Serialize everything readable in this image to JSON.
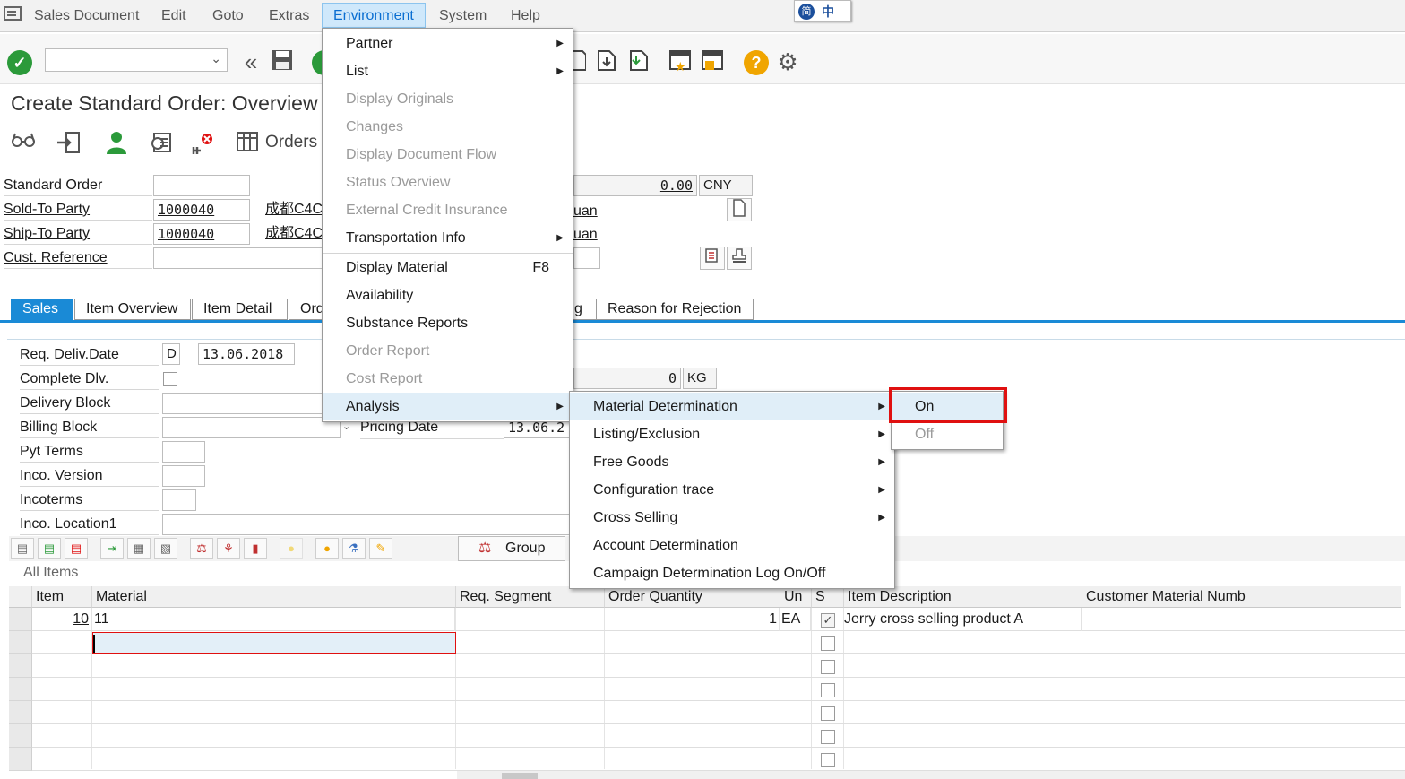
{
  "menubar": {
    "items": [
      "Sales Document",
      "Edit",
      "Goto",
      "Extras",
      "Environment",
      "System",
      "Help"
    ],
    "active": "Environment",
    "ime": {
      "a": "简",
      "b": "中"
    }
  },
  "title": "Create Standard Order: Overview",
  "app_toolbar": {
    "orders_label": "Orders"
  },
  "header": {
    "standard_order_label": "Standard Order",
    "sold_to_label": "Sold-To Party",
    "sold_to_value": "1000040",
    "sold_to_name": "成都C4C",
    "ship_to_label": "Ship-To Party",
    "ship_to_value": "1000040",
    "ship_to_name": "成都C4C",
    "cust_ref_label": "Cust. Reference",
    "net_value": "0.00",
    "currency": "CNY",
    "partial_uan_1": "uan",
    "partial_uan_2": "uan"
  },
  "tabs": [
    "Sales",
    "Item Overview",
    "Item Detail",
    "Ord",
    "g",
    "Reason for Rejection"
  ],
  "sales_tab": {
    "req_deliv_label": "Req. Deliv.Date",
    "req_deliv_type": "D",
    "req_deliv_value": "13.06.2018",
    "complete_dlv_label": "Complete Dlv.",
    "delivery_block_label": "Delivery Block",
    "billing_block_label": "Billing Block",
    "pyt_terms_label": "Pyt Terms",
    "inco_version_label": "Inco. Version",
    "incoterms_label": "Incoterms",
    "inco_location_label": "Inco. Location1",
    "weight_value": "0",
    "weight_unit": "KG",
    "pricing_date_label": "Pricing Date",
    "pricing_date_value": "13.06.2"
  },
  "items": {
    "group_label": "Group",
    "all_items_label": "All Items",
    "columns": [
      "Item",
      "Material",
      "Req. Segment",
      "Order Quantity",
      "Un",
      "S",
      "Item Description",
      "Customer Material Numb"
    ],
    "rows": [
      {
        "item": "10",
        "material": "11",
        "req_segment": "",
        "quantity": "1",
        "unit": "EA",
        "checked": true,
        "description": "Jerry cross selling product A",
        "cust_mat": ""
      }
    ]
  },
  "environment_menu": [
    {
      "label": "Partner",
      "disabled": false,
      "submenu": true
    },
    {
      "label": "List",
      "disabled": false,
      "submenu": true
    },
    {
      "label": "Display Originals",
      "disabled": true
    },
    {
      "label": "Changes",
      "disabled": true
    },
    {
      "label": "Display Document Flow",
      "disabled": true
    },
    {
      "label": "Status Overview",
      "disabled": true
    },
    {
      "label": "External Credit Insurance",
      "disabled": true
    },
    {
      "label": "Transportation Info",
      "disabled": false,
      "submenu": true
    },
    {
      "label": "Display Material",
      "disabled": false,
      "shortcut": "F8"
    },
    {
      "label": "Availability",
      "disabled": false
    },
    {
      "label": "Substance Reports",
      "disabled": false
    },
    {
      "label": "Order Report",
      "disabled": true
    },
    {
      "label": "Cost Report",
      "disabled": true
    },
    {
      "label": "Analysis",
      "disabled": false,
      "submenu": true,
      "highlighted": true
    }
  ],
  "analysis_menu": [
    {
      "label": "Material Determination",
      "submenu": true,
      "highlighted": true
    },
    {
      "label": "Listing/Exclusion",
      "submenu": true
    },
    {
      "label": "Free Goods",
      "submenu": true
    },
    {
      "label": "Configuration trace",
      "submenu": true
    },
    {
      "label": "Cross Selling",
      "submenu": true
    },
    {
      "label": "Account Determination",
      "submenu": false
    },
    {
      "label": "Campaign Determination Log On/Off",
      "submenu": false
    }
  ],
  "material_determination_menu": [
    {
      "label": "On",
      "disabled": false,
      "highlighted": true
    },
    {
      "label": "Off",
      "disabled": true
    }
  ],
  "colors": {
    "accent": "#1a8ad6",
    "highlight_box": "#e01010",
    "ok_green": "#2b9a3a",
    "help_orange": "#f0a500"
  }
}
